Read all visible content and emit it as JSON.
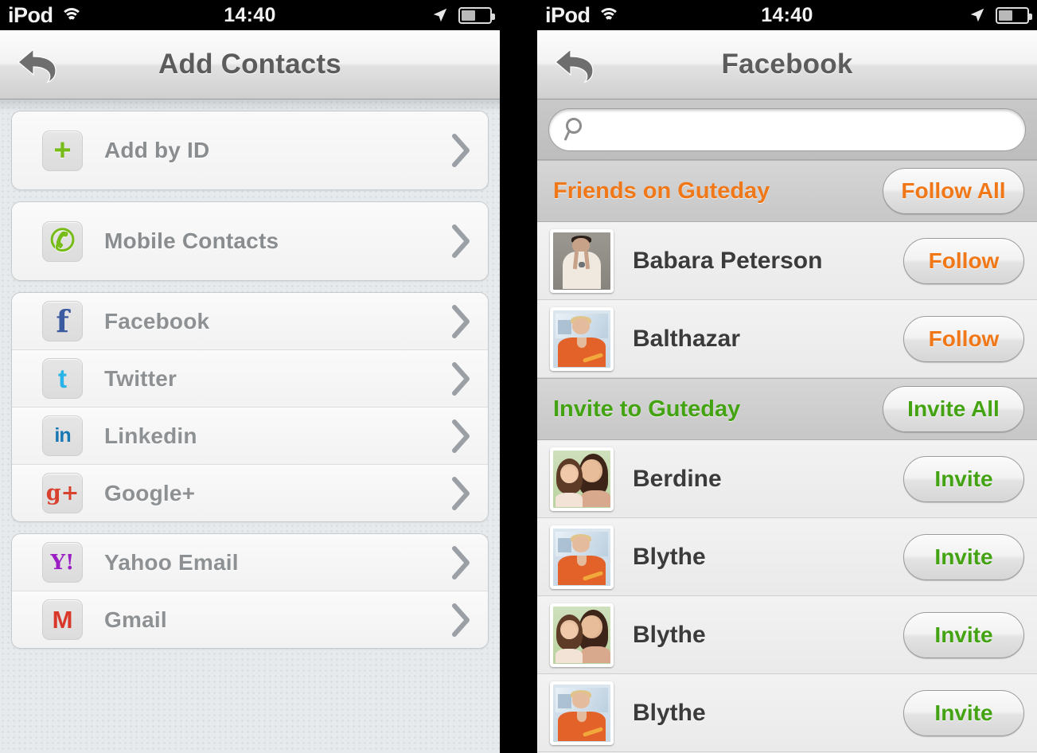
{
  "statusbar": {
    "carrier": "iPod",
    "time": "14:40",
    "wifi_icon": "wifi-icon",
    "location_icon": "location-arrow-icon",
    "battery_icon": "battery-icon",
    "battery_level_pct": 45
  },
  "colors": {
    "orange": "#f07818",
    "green": "#44a312",
    "label_gray": "#8e9193",
    "name_dark": "#3b3b3b",
    "nav_title": "#5c5c5c"
  },
  "left_screen": {
    "nav": {
      "title": "Add Contacts",
      "back_icon": "back-arrow-icon"
    },
    "groups": [
      {
        "id": "add-by-id",
        "tall": true,
        "items": [
          {
            "label": "Add by ID",
            "icon": "plus-icon",
            "glyph": "+",
            "glyph_class": "g-plus"
          }
        ]
      },
      {
        "id": "mobile",
        "tall": true,
        "items": [
          {
            "label": "Mobile Contacts",
            "icon": "phone-handset-icon",
            "glyph": "✆",
            "glyph_class": "g-plus"
          }
        ]
      },
      {
        "id": "social",
        "tall": false,
        "items": [
          {
            "label": "Facebook",
            "icon": "facebook-icon",
            "glyph": "f",
            "glyph_class": "g-fb"
          },
          {
            "label": "Twitter",
            "icon": "twitter-icon",
            "glyph": "t",
            "glyph_class": "g-tw"
          },
          {
            "label": "Linkedin",
            "icon": "linkedin-icon",
            "glyph": "in",
            "glyph_class": "g-li"
          },
          {
            "label": "Google+",
            "icon": "google-plus-icon",
            "glyph": "g+",
            "glyph_class": "g-gp"
          }
        ]
      },
      {
        "id": "email",
        "tall": false,
        "items": [
          {
            "label": "Yahoo Email",
            "icon": "yahoo-icon",
            "glyph": "Y!",
            "glyph_class": "g-yh"
          },
          {
            "label": "Gmail",
            "icon": "gmail-icon",
            "glyph": "M",
            "glyph_class": "g-gm"
          }
        ]
      }
    ],
    "chevron_icon": "chevron-right-icon"
  },
  "right_screen": {
    "nav": {
      "title": "Facebook",
      "back_icon": "back-arrow-icon"
    },
    "search": {
      "value": "",
      "placeholder": "",
      "icon": "search-icon"
    },
    "sections": [
      {
        "id": "friends-on-guteday",
        "title": "Friends on Guteday",
        "action_label": "Follow All",
        "action_name": "follow-all-button",
        "color": "#f07818",
        "people": [
          {
            "name": "Babara Peterson",
            "action": "Follow",
            "avatar": "av-man"
          },
          {
            "name": "Balthazar",
            "action": "Follow",
            "avatar": "av-woman"
          }
        ]
      },
      {
        "id": "invite-to-guteday",
        "title": "Invite to Guteday",
        "action_label": "Invite All",
        "action_name": "invite-all-button",
        "color": "#44a312",
        "people": [
          {
            "name": "Berdine",
            "action": "Invite",
            "avatar": "av-two"
          },
          {
            "name": "Blythe",
            "action": "Invite",
            "avatar": "av-woman"
          },
          {
            "name": "Blythe",
            "action": "Invite",
            "avatar": "av-two"
          },
          {
            "name": "Blythe",
            "action": "Invite",
            "avatar": "av-woman"
          }
        ]
      }
    ]
  }
}
